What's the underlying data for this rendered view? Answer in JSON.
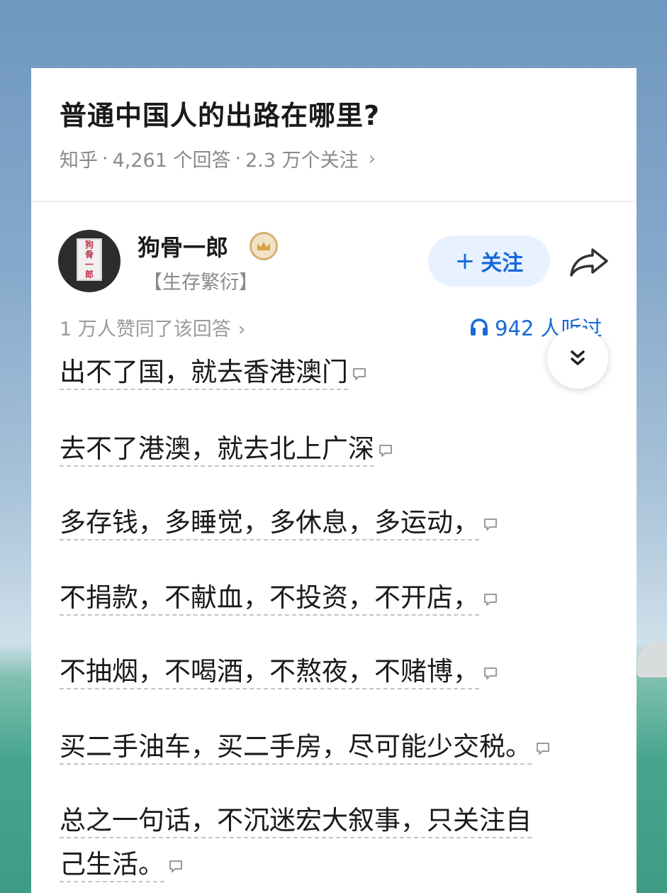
{
  "question": {
    "title": "普通中国人的出路在哪里?",
    "source": "知乎",
    "answers": "4,261 个回答",
    "followers": "2.3 万个关注"
  },
  "author": {
    "name": "狗骨一郎",
    "tagline": "【生存繁衍】",
    "avatar_chars": [
      "狗",
      "骨",
      "一",
      "郎"
    ],
    "badge_icon": "crown-badge-icon"
  },
  "follow": {
    "label": "关注"
  },
  "stats": {
    "approvals": "1 万人赞同了该回答",
    "listens": "942 人听过"
  },
  "answer_lines": [
    "出不了国，就去香港澳门",
    "去不了港澳，就去北上广深",
    "多存钱，多睡觉，多休息，多运动，",
    "不捐款，不献血，不投资，不开店，",
    "不抽烟，不喝酒，不熬夜，不赌博，",
    "买二手油车，买二手房，尽可能少交税。",
    "总之一句话，不沉迷宏大叙事，只关注自",
    "己生活。"
  ],
  "colors": {
    "accent": "#1768d9",
    "follow_bg": "#e8f1ff",
    "badge": "#d8b070"
  }
}
